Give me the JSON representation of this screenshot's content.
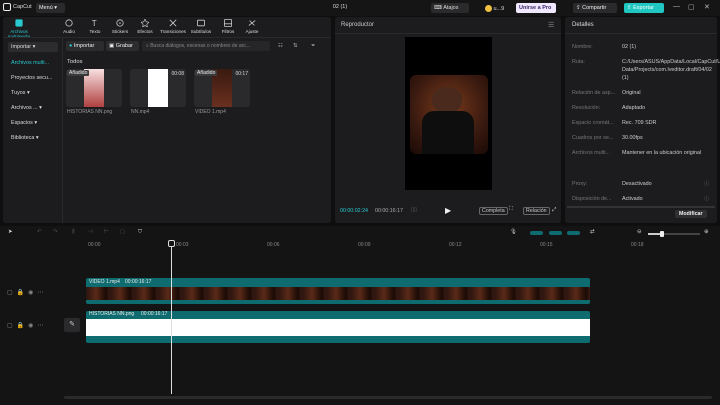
{
  "app": {
    "name": "CapCut",
    "menu_label": "Menú ▾",
    "project_title": "02 (1)"
  },
  "topbar": {
    "shortcuts_label": "Atajos",
    "user_label": "u...9",
    "join_pro_label": "Unirse a Pro",
    "share_label": "Compartir",
    "export_label": "Exportar"
  },
  "toolbar": {
    "items": [
      {
        "label": "Archivos multimedia",
        "icon": "media-icon"
      },
      {
        "label": "Audio",
        "icon": "audio-icon"
      },
      {
        "label": "Texto",
        "icon": "text-icon"
      },
      {
        "label": "Stickers",
        "icon": "sticker-icon"
      },
      {
        "label": "Efectos",
        "icon": "effects-icon"
      },
      {
        "label": "Transiciones",
        "icon": "transition-icon"
      },
      {
        "label": "Subtítulos",
        "icon": "subtitles-icon"
      },
      {
        "label": "Filtros",
        "icon": "filter-icon"
      },
      {
        "label": "Ajuste",
        "icon": "adjust-icon"
      }
    ]
  },
  "sidebar": {
    "items": [
      {
        "label": "Importar ▾"
      },
      {
        "label": "Archivos multi..."
      },
      {
        "label": "Proyectos secu..."
      },
      {
        "label": "Tuyos ▾"
      },
      {
        "label": "Archivos ... ▾"
      },
      {
        "label": "Espacios ▾"
      },
      {
        "label": "Biblioteca ▾"
      }
    ]
  },
  "media": {
    "import_label": "Importar",
    "record_label": "Grabar",
    "search_placeholder": "Busca diálogos, escenas o nombres de arc...",
    "section_title": "Todos",
    "items": [
      {
        "name": "HISTORIAS NN.png",
        "badge": "Añadido",
        "duration": ""
      },
      {
        "name": "NN.mp4",
        "badge": "",
        "duration": "00:08"
      },
      {
        "name": "VIDEO 1.mp4",
        "badge": "Añadido",
        "duration": "00:17"
      }
    ]
  },
  "player": {
    "title": "Reproductor",
    "current_time": "00:00:02:24",
    "total_time": "00:00:16:17",
    "full_label": "Completa",
    "ratio_label": "Relación"
  },
  "details": {
    "title": "Detalles",
    "rows": [
      {
        "label": "Nombre:",
        "value": "02 (1)"
      },
      {
        "label": "Ruta:",
        "value": "C:/Users/ASUS/AppData/Local/CapCut/User Data/Projects/com.lveditor.draft/04/02 (1)"
      },
      {
        "label": "Relación de asp...",
        "value": "Original"
      },
      {
        "label": "Resolución:",
        "value": "Adaptado"
      },
      {
        "label": "Espacio cromát...",
        "value": "Rec. 709 SDR"
      },
      {
        "label": "Cuadros por se...",
        "value": "30.00fps"
      },
      {
        "label": "Archivos multi...",
        "value": "Mantener en la ubicación original"
      },
      {
        "label": "Proxy:",
        "value": "Desactivado"
      },
      {
        "label": "Disposición de...",
        "value": "Activado"
      }
    ],
    "modify_label": "Modificar"
  },
  "timeline": {
    "ruler": [
      "00:00",
      "00:03",
      "00:06",
      "00:09",
      "00:12",
      "00:15",
      "00:18"
    ],
    "clips": [
      {
        "name": "VIDEO 1.mp4",
        "duration": "00:00:16:17"
      },
      {
        "name": "HISTORIAS NN.png",
        "duration": "00:00:16:17"
      }
    ]
  },
  "colors": {
    "accent": "#28c9d0",
    "export": "#1fc7c0",
    "clip_teal": "#0e6b6f",
    "white": "#ffffff"
  }
}
